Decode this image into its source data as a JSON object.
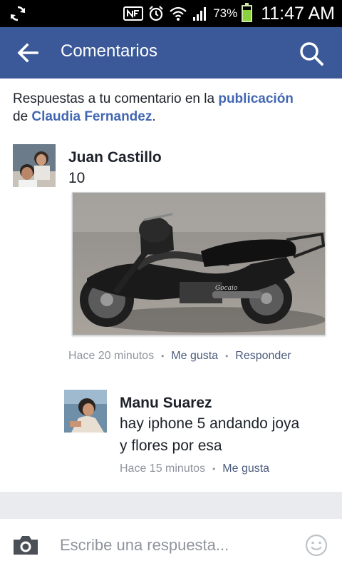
{
  "status_bar": {
    "battery_percent": "73%",
    "battery_level": 0.73,
    "time": "11:47 AM"
  },
  "app_bar": {
    "title": "Comentarios",
    "back_icon": "arrow-left",
    "search_icon": "search"
  },
  "header_note": {
    "prefix": "Respuestas a tu comentario en la ",
    "link1": "publicación",
    "middle": " de ",
    "link2": "Claudia Fernandez",
    "suffix": "."
  },
  "comment": {
    "author": "Juan Castillo",
    "text": "10",
    "time": "Hace 20 minutos",
    "like": "Me gusta",
    "reply": "Responder"
  },
  "reply": {
    "author": "Manu Suarez",
    "text_line1": "hay iphone 5 andando joya",
    "text_line2": "y flores por esa",
    "time": "Hace 15 minutos",
    "like": "Me gusta"
  },
  "composer": {
    "placeholder": "Escribe una respuesta...",
    "camera_icon": "camera",
    "emoji_icon": "smiley"
  },
  "colors": {
    "app_bar": "#3b5998",
    "link": "#4267b2",
    "meta": "#90949c"
  }
}
